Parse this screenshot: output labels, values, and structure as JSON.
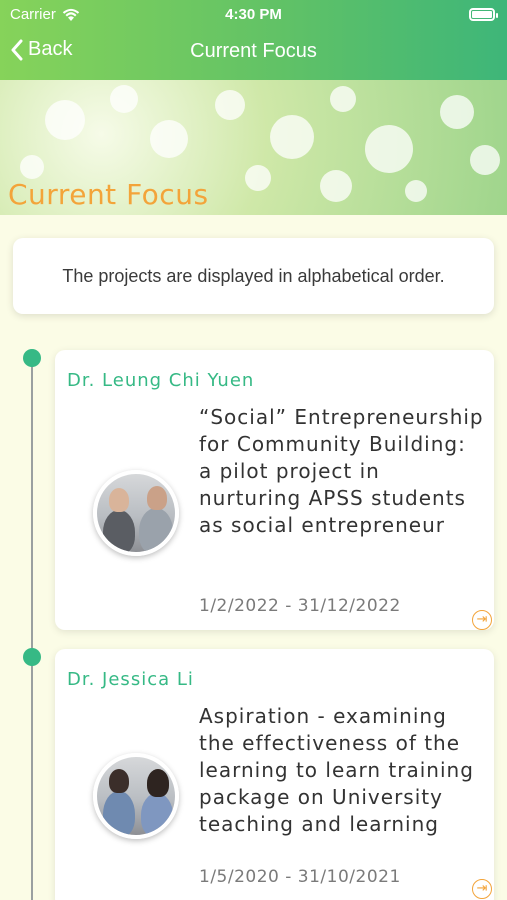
{
  "status": {
    "carrier": "Carrier",
    "time": "4:30 PM"
  },
  "nav": {
    "back_label": "Back",
    "title": "Current Focus"
  },
  "banner": {
    "title": "Current Focus"
  },
  "notice": {
    "text": "The projects are displayed in alphabetical order."
  },
  "projects": [
    {
      "name": "Dr. Leung Chi Yuen",
      "title": "“Social” Entrepreneurship for Community Building: a pilot project in nurturing APSS students as social entrepreneur",
      "dates": "1/2/2022 - 31/12/2022"
    },
    {
      "name": "Dr. Jessica Li",
      "title": "Aspiration - examining the effectiveness of the learning to learn training package on University teaching and learning",
      "dates": "1/5/2020 - 31/10/2021"
    }
  ],
  "colors": {
    "accent_green": "#36b985",
    "accent_orange": "#f3a43a",
    "background": "#fbfce6"
  },
  "icons": [
    "wifi-icon",
    "battery-icon",
    "chevron-left-icon",
    "arrow-right-circle-icon"
  ]
}
